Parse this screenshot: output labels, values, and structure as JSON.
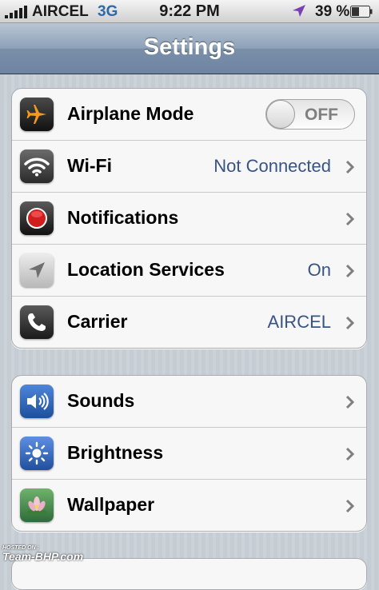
{
  "status_bar": {
    "carrier": "AIRCEL",
    "network": "3G",
    "time": "9:22 PM",
    "battery_percent": "39 %",
    "signal_bars": 5
  },
  "nav": {
    "title": "Settings"
  },
  "groups": [
    {
      "rows": [
        {
          "label": "Airplane Mode",
          "icon": "airplane-icon",
          "toggle": "OFF"
        },
        {
          "label": "Wi-Fi",
          "icon": "wifi-icon",
          "value": "Not Connected"
        },
        {
          "label": "Notifications",
          "icon": "notifications-icon"
        },
        {
          "label": "Location Services",
          "icon": "location-services-icon",
          "value": "On"
        },
        {
          "label": "Carrier",
          "icon": "phone-icon",
          "value": "AIRCEL"
        }
      ]
    },
    {
      "rows": [
        {
          "label": "Sounds",
          "icon": "speaker-icon"
        },
        {
          "label": "Brightness",
          "icon": "sun-icon"
        },
        {
          "label": "Wallpaper",
          "icon": "flower-icon"
        }
      ]
    }
  ],
  "watermark": {
    "small": "HOSTED ON :",
    "big": "Team-BHP.com"
  },
  "colors": {
    "value_blue": "#385487",
    "nav_bar": "#7a8fa8",
    "background": "#c5ccd4"
  }
}
